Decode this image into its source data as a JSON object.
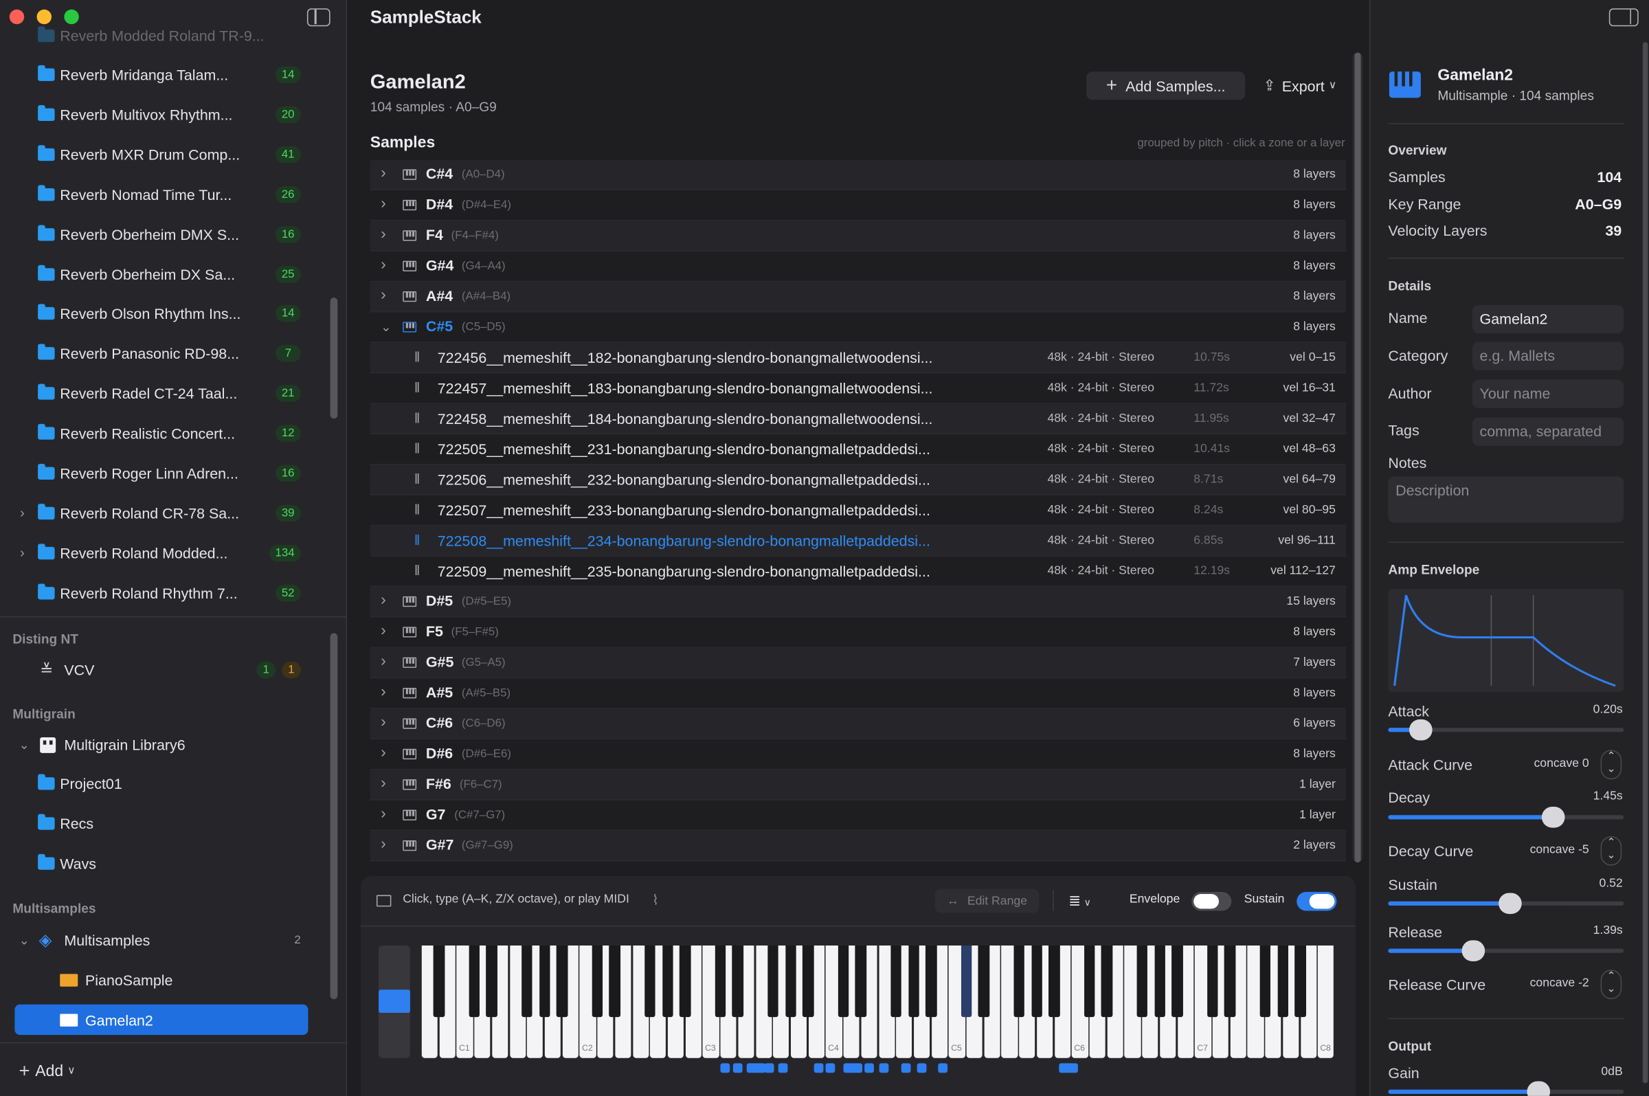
{
  "sidebar": {
    "top_partial_item": "Reverb Modded Roland TR-9...",
    "items": [
      {
        "label": "Reverb Mridanga Talam...",
        "count": "14"
      },
      {
        "label": "Reverb Multivox Rhythm...",
        "count": "20"
      },
      {
        "label": "Reverb MXR Drum Comp...",
        "count": "41"
      },
      {
        "label": "Reverb Nomad Time Tur...",
        "count": "26"
      },
      {
        "label": "Reverb Oberheim DMX S...",
        "count": "16"
      },
      {
        "label": "Reverb Oberheim DX Sa...",
        "count": "25"
      },
      {
        "label": "Reverb Olson Rhythm Ins...",
        "count": "14"
      },
      {
        "label": "Reverb Panasonic RD-98...",
        "count": "7"
      },
      {
        "label": "Reverb Radel CT-24 Taal...",
        "count": "21"
      },
      {
        "label": "Reverb Realistic Concert...",
        "count": "12"
      },
      {
        "label": "Reverb Roger Linn Adren...",
        "count": "16"
      },
      {
        "label": "Reverb Roland CR-78 Sa...",
        "count": "39"
      },
      {
        "label": "Reverb Roland Modded...",
        "count": "134"
      },
      {
        "label": "Reverb Roland Rhythm 7...",
        "count": "52"
      }
    ],
    "disting_header": "Disting NT",
    "disting_item": {
      "label": "VCV",
      "count_a": "1",
      "count_b": "1"
    },
    "multigrain_header": "Multigrain",
    "multigrain_library": "Multigrain Library6",
    "multigrain_children": [
      "Project01",
      "Recs",
      "Wavs"
    ],
    "multisamples_header": "Multisamples",
    "multisamples_group": {
      "label": "Multisamples",
      "count": "2"
    },
    "multisample_items": [
      "PianoSample",
      "Gamelan2"
    ],
    "add_label": "Add"
  },
  "app": {
    "title": "SampleStack"
  },
  "main": {
    "title": "Gamelan2",
    "subtitle": "104 samples · A0–G9",
    "add_button": "Add Samples...",
    "export_button": "Export",
    "samples_header": "Samples",
    "samples_hint": "grouped by pitch · click a zone or a layer"
  },
  "groups_before": [
    {
      "note": "C#4",
      "range": "(A0–D4)",
      "layers": "8 layers"
    },
    {
      "note": "D#4",
      "range": "(D#4–E4)",
      "layers": "8 layers"
    },
    {
      "note": "F4",
      "range": "(F4–F#4)",
      "layers": "8 layers"
    },
    {
      "note": "G#4",
      "range": "(G4–A4)",
      "layers": "8 layers"
    },
    {
      "note": "A#4",
      "range": "(A#4–B4)",
      "layers": "8 layers"
    }
  ],
  "expanded_group": {
    "note": "C#5",
    "range": "(C5–D5)",
    "layers": "8 layers"
  },
  "samples": [
    {
      "name": "722456__memeshift__182-bonangbarung-slendro-bonangmalletwoodensi...",
      "format": "48k · 24-bit · Stereo",
      "duration": "10.75s",
      "vel": "vel 0–15"
    },
    {
      "name": "722457__memeshift__183-bonangbarung-slendro-bonangmalletwoodensi...",
      "format": "48k · 24-bit · Stereo",
      "duration": "11.72s",
      "vel": "vel 16–31"
    },
    {
      "name": "722458__memeshift__184-bonangbarung-slendro-bonangmalletwoodensi...",
      "format": "48k · 24-bit · Stereo",
      "duration": "11.95s",
      "vel": "vel 32–47"
    },
    {
      "name": "722505__memeshift__231-bonangbarung-slendro-bonangmalletpaddedsi...",
      "format": "48k · 24-bit · Stereo",
      "duration": "10.41s",
      "vel": "vel 48–63"
    },
    {
      "name": "722506__memeshift__232-bonangbarung-slendro-bonangmalletpaddedsi...",
      "format": "48k · 24-bit · Stereo",
      "duration": "8.71s",
      "vel": "vel 64–79"
    },
    {
      "name": "722507__memeshift__233-bonangbarung-slendro-bonangmalletpaddedsi...",
      "format": "48k · 24-bit · Stereo",
      "duration": "8.24s",
      "vel": "vel 80–95"
    },
    {
      "name": "722508__memeshift__234-bonangbarung-slendro-bonangmalletpaddedsi...",
      "format": "48k · 24-bit · Stereo",
      "duration": "6.85s",
      "vel": "vel 96–111"
    },
    {
      "name": "722509__memeshift__235-bonangbarung-slendro-bonangmalletpaddedsi...",
      "format": "48k · 24-bit · Stereo",
      "duration": "12.19s",
      "vel": "vel 112–127"
    }
  ],
  "groups_after": [
    {
      "note": "D#5",
      "range": "(D#5–E5)",
      "layers": "15 layers"
    },
    {
      "note": "F5",
      "range": "(F5–F#5)",
      "layers": "8 layers"
    },
    {
      "note": "G#5",
      "range": "(G5–A5)",
      "layers": "7 layers"
    },
    {
      "note": "A#5",
      "range": "(A#5–B5)",
      "layers": "8 layers"
    },
    {
      "note": "C#6",
      "range": "(C6–D6)",
      "layers": "6 layers"
    },
    {
      "note": "D#6",
      "range": "(D#6–E6)",
      "layers": "8 layers"
    },
    {
      "note": "F#6",
      "range": "(F6–C7)",
      "layers": "1 layer"
    },
    {
      "note": "G7",
      "range": "(C#7–G7)",
      "layers": "1 layer"
    },
    {
      "note": "G#7",
      "range": "(G#7–G9)",
      "layers": "2 layers"
    }
  ],
  "keyboard": {
    "hint": "Click, type (A–K, Z/X octave), or play MIDI",
    "edit_range": "Edit Range",
    "envelope_label": "Envelope",
    "sustain_label": "Sustain",
    "octave_labels": [
      "C1",
      "C2",
      "C3",
      "C4",
      "C5",
      "C6",
      "C7",
      "C8"
    ],
    "pressed_key": "C#5"
  },
  "inspector": {
    "title": "Gamelan2",
    "subtitle": "Multisample · 104 samples",
    "overview_header": "Overview",
    "overview": [
      {
        "label": "Samples",
        "value": "104"
      },
      {
        "label": "Key Range",
        "value": "A0–G9"
      },
      {
        "label": "Velocity Layers",
        "value": "39"
      }
    ],
    "details_header": "Details",
    "name_label": "Name",
    "name_value": "Gamelan2",
    "category_label": "Category",
    "category_placeholder": "e.g. Mallets",
    "author_label": "Author",
    "author_placeholder": "Your name",
    "tags_label": "Tags",
    "tags_placeholder": "comma, separated",
    "notes_label": "Notes",
    "notes_placeholder": "Description",
    "amp_header": "Amp Envelope",
    "attack_label": "Attack",
    "attack_value": "0.20s",
    "attack_curve_label": "Attack Curve",
    "attack_curve_value": "concave 0",
    "decay_label": "Decay",
    "decay_value": "1.45s",
    "decay_curve_label": "Decay Curve",
    "decay_curve_value": "concave -5",
    "sustain_label": "Sustain",
    "sustain_value": "0.52",
    "release_label": "Release",
    "release_value": "1.39s",
    "release_curve_label": "Release Curve",
    "release_curve_value": "concave -2",
    "output_header": "Output",
    "gain_label": "Gain",
    "gain_value": "0dB",
    "slider_levels": {
      "attack": 0.14,
      "decay": 0.7,
      "sustain": 0.52,
      "release": 0.36,
      "gain": 0.64
    }
  },
  "colors": {
    "accent": "#2f7ff0",
    "badge_green": "#4cd964",
    "badge_orange": "#e3a33a",
    "folder": "#2a9bf0",
    "selected_row": "#1f6fe0"
  }
}
